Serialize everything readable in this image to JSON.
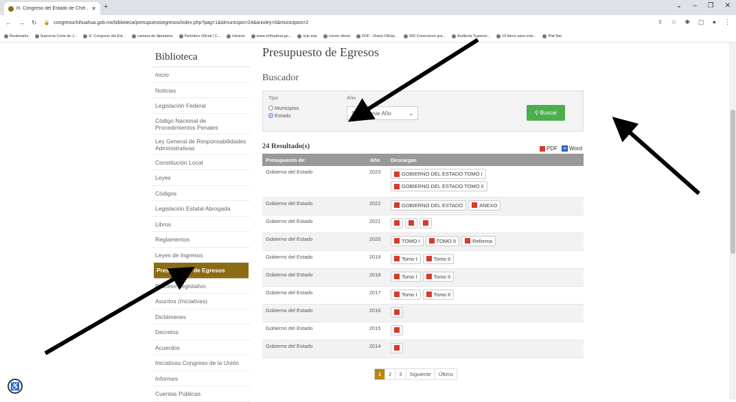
{
  "browser": {
    "tab_title": "H. Congreso del Estado de Chih...",
    "tab_close": "✕",
    "new_tab": "+",
    "url": "congresochihuahua.gob.mx/biblioteca/presupuestoegresos/index.php?pag=1&idmunicipio=24&anioley=0&municipios=2",
    "bookmarks": [
      "Bookmarks",
      "Suprema Corte de J...",
      "H. Congreso del Est...",
      "camara de diputados",
      "Periódico Oficial | C...",
      "intranet",
      "www.chihuahua.go...",
      "scjn exp",
      "correo oficial",
      "DOF - Diario Oficial...",
      "500 Conectores gra...",
      "Auditoria Superior...",
      "10 libros para ente...",
      "Plat Nal"
    ]
  },
  "sidebar": {
    "title": "Biblioteca",
    "items": [
      "Inicio",
      "Noticias",
      "Legislación Federal",
      "Código Nacional de Procedimientos Penales",
      "Ley General de Responsabilidades Administrativas",
      "Constitución Local",
      "Leyes",
      "Códigos",
      "Legislación Estatal Abrogada",
      "Libros",
      "Reglamentos",
      "Leyes de Ingresos",
      "Presupuesto de Egresos",
      "Proceso Legislativo",
      "Asuntos (Iniciativas)",
      "Dictámenes",
      "Decretos",
      "Acuerdos",
      "Iniciativas Congreso de la Unión",
      "Informes",
      "Cuentas Públicas"
    ]
  },
  "main": {
    "title": "Presupuesto de Egresos",
    "search_title": "Buscador",
    "tipo_label": "Tipo",
    "anio_label": "Año",
    "radio_municipios": "Municipios",
    "radio_estado": "Estado",
    "select_value": "Seleccionar Año",
    "search_button": "Buscar",
    "results_count": "24 Resultado(s)",
    "export_pdf": "PDF",
    "export_word": "Word",
    "table": {
      "headers": [
        "Presupuesto de:",
        "Año",
        "Descargas"
      ],
      "rows": [
        {
          "name": "Gobierno del Estado",
          "year": "2023",
          "downloads": [
            "GOBIERNO DEL ESTADO TOMO I",
            "GOBIERNO DEL ESTADO TOMO II"
          ]
        },
        {
          "name": "Gobierno del Estado",
          "year": "2022",
          "downloads": [
            "GOBIERNO DEL ESTADO",
            "ANEXO"
          ]
        },
        {
          "name": "Gobierno del Estado",
          "year": "2021",
          "downloads": [
            "",
            "",
            ""
          ]
        },
        {
          "name": "Gobierno del Estado",
          "year": "2020",
          "downloads": [
            "TOMO I",
            "TOMO II",
            "Reforma"
          ]
        },
        {
          "name": "Gobierno del Estado",
          "year": "2019",
          "downloads": [
            "Tomo I",
            "Tomo II"
          ]
        },
        {
          "name": "Gobierno del Estado",
          "year": "2018",
          "downloads": [
            "Tomo I",
            "Tomo II"
          ]
        },
        {
          "name": "Gobierno del Estado",
          "year": "2017",
          "downloads": [
            "Tomo I",
            "Tomo II"
          ]
        },
        {
          "name": "Gobierno del Estado",
          "year": "2016",
          "downloads": [
            ""
          ]
        },
        {
          "name": "Gobierno del Estado",
          "year": "2015",
          "downloads": [
            ""
          ]
        },
        {
          "name": "Gobierno del Estado",
          "year": "2014",
          "downloads": [
            ""
          ]
        }
      ]
    },
    "pagination": [
      "1",
      "2",
      "3",
      "Siguiente",
      "Último"
    ]
  }
}
